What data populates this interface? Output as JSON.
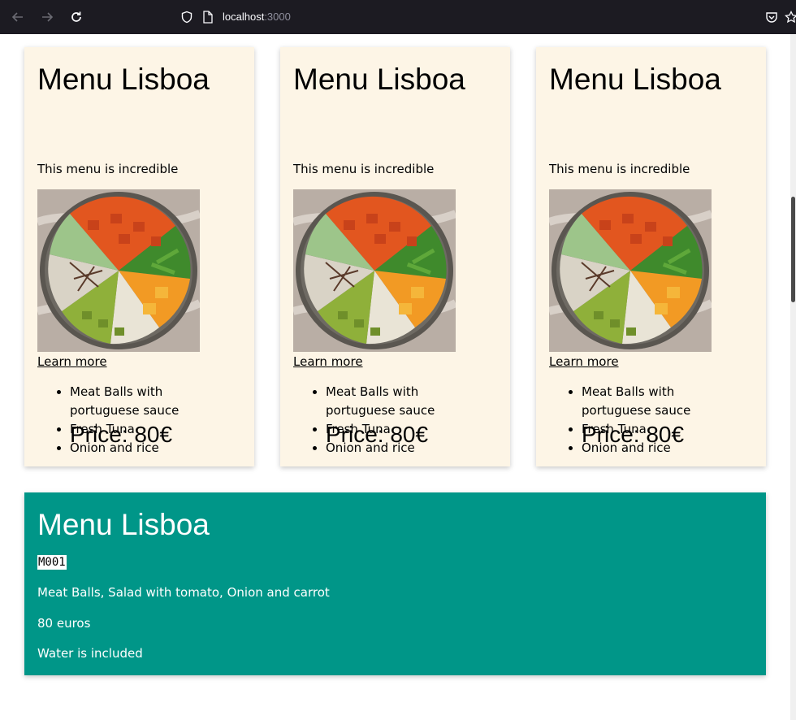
{
  "browser": {
    "url_host": "localhost",
    "url_port": ":3000"
  },
  "cards": [
    {
      "title": "Menu Lisboa",
      "description": "This menu is incredible",
      "learn_more": "Learn more",
      "items": [
        "Meat Balls with portuguese sauce",
        "Fresh Tuna",
        "Onion and rice"
      ],
      "price": "Price: 80€"
    },
    {
      "title": "Menu Lisboa",
      "description": "This menu is incredible",
      "learn_more": "Learn more",
      "items": [
        "Meat Balls with portuguese sauce",
        "Fresh Tuna",
        "Onion and rice"
      ],
      "price": "Price: 80€"
    },
    {
      "title": "Menu Lisboa",
      "description": "This menu is incredible",
      "learn_more": "Learn more",
      "items": [
        "Meat Balls with portuguese sauce",
        "Fresh Tuna",
        "Onion and rice"
      ],
      "price": "Price: 80€"
    }
  ],
  "detail": {
    "title": "Menu Lisboa",
    "code": "M001",
    "ingredients": "Meat Balls, Salad with tomato, Onion and carrot",
    "price": "80 euros",
    "note": "Water is included"
  },
  "colors": {
    "card_background": "#fdf5e6",
    "panel_background": "#009688",
    "toolbar_background": "#1c1b22"
  },
  "icons": [
    "back-arrow-icon",
    "forward-arrow-icon",
    "reload-icon",
    "shield-icon",
    "page-icon",
    "pocket-icon",
    "bookmark-star-icon"
  ]
}
